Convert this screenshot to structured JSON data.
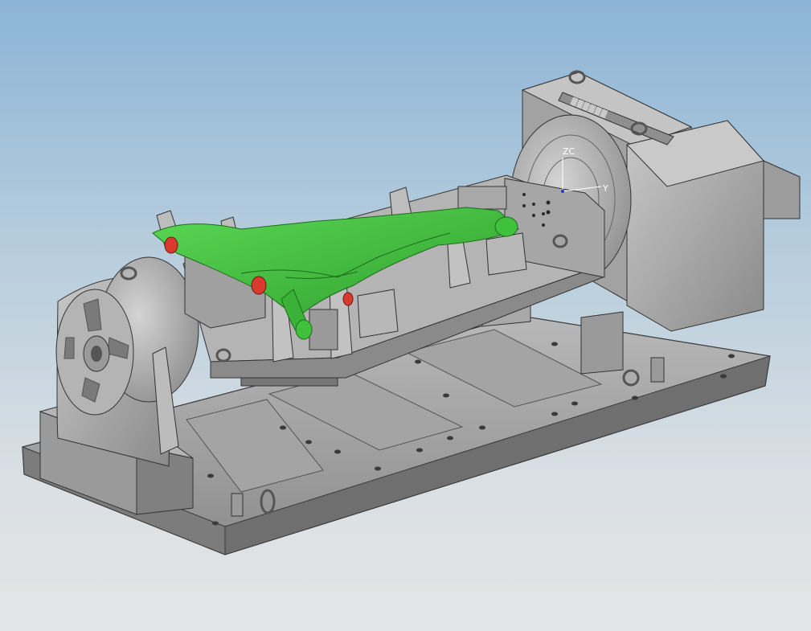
{
  "viewport": {
    "background_top": "#8cb4d6",
    "background_bottom": "#e4e5e6"
  },
  "wcs_triad": {
    "z_label": "ZC",
    "x_label": "Y"
  },
  "model": {
    "part_color": "#3fc13c",
    "fixture_color": "#a9a9a9",
    "hole_highlight": "#d83a2e"
  },
  "nameplate": {
    "text": "▓▓▓▓▓▓"
  }
}
